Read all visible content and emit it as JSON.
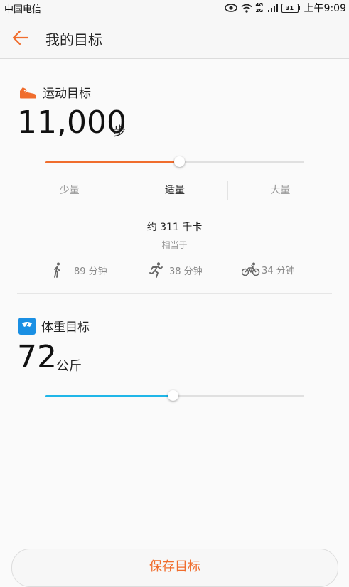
{
  "statusbar": {
    "carrier": "中国电信",
    "network": "4G 2G",
    "battery": "31",
    "time": "上午9:09"
  },
  "appbar": {
    "title": "我的目标"
  },
  "steps_goal": {
    "section_label": "运动目标",
    "value": "11,000",
    "unit": "步",
    "slider_fraction": 0.52,
    "levels": [
      {
        "label": "少量"
      },
      {
        "label": "适量"
      },
      {
        "label": "大量"
      }
    ],
    "active_level": "适量",
    "kcal": "约 311 千卡",
    "equivalent_label": "相当于",
    "activities": [
      {
        "icon": "walking-icon",
        "label": "89 分钟"
      },
      {
        "icon": "running-icon",
        "label": "38 分钟"
      },
      {
        "icon": "cycling-icon",
        "label": "34 分钟"
      }
    ]
  },
  "weight_goal": {
    "section_label": "体重目标",
    "value": "72",
    "unit": "公斤",
    "slider_fraction": 0.495
  },
  "save_button": {
    "label": "保存目标"
  },
  "colors": {
    "accent_orange": "#f06d2d",
    "accent_blue": "#1fb6e8",
    "text_dark": "#222222",
    "text_muted": "#999999"
  }
}
